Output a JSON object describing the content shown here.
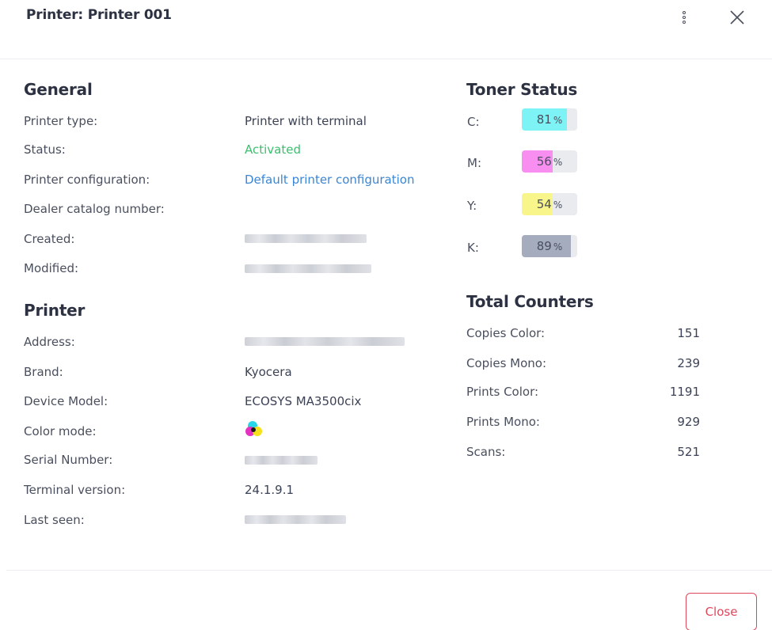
{
  "dialog": {
    "title": "Printer: Printer 001",
    "close_button_label": "Close"
  },
  "general": {
    "heading": "General",
    "rows": [
      {
        "label": "Printer type:",
        "value": "Printer with terminal"
      },
      {
        "label": "Status:",
        "value": "Activated"
      },
      {
        "label": "Printer configuration:",
        "value": "Default printer configuration"
      },
      {
        "label": "Dealer catalog number:",
        "value": ""
      },
      {
        "label": "Created:",
        "value": ""
      },
      {
        "label": "Modified:",
        "value": ""
      }
    ]
  },
  "printer": {
    "heading": "Printer",
    "rows": [
      {
        "label": "Address:",
        "value": ""
      },
      {
        "label": "Brand:",
        "value": "Kyocera"
      },
      {
        "label": "Device Model:",
        "value": "ECOSYS MA3500cix"
      },
      {
        "label": "Color mode:",
        "value": ""
      },
      {
        "label": "Serial Number:",
        "value": ""
      },
      {
        "label": "Terminal version:",
        "value": "24.1.9.1"
      },
      {
        "label": "Last seen:",
        "value": ""
      }
    ]
  },
  "toner": {
    "heading": "Toner Status",
    "unit": "%",
    "items": [
      {
        "label": "C:",
        "value": "81",
        "level": 0.81,
        "color": "#7ef3f5"
      },
      {
        "label": "M:",
        "value": "56",
        "level": 0.56,
        "color": "#f78ef0"
      },
      {
        "label": "Y:",
        "value": "54",
        "level": 0.54,
        "color": "#f8f68a"
      },
      {
        "label": "K:",
        "value": "89",
        "level": 0.89,
        "color": "#a4acbd"
      }
    ]
  },
  "counters": {
    "heading": "Total Counters",
    "rows": [
      {
        "label": "Copies Color:",
        "value": "151"
      },
      {
        "label": "Copies Mono:",
        "value": "239"
      },
      {
        "label": "Prints Color:",
        "value": "1191"
      },
      {
        "label": "Prints Mono:",
        "value": "929"
      },
      {
        "label": "Scans:",
        "value": "521"
      }
    ]
  },
  "icons": {
    "more": "more-vertical-icon",
    "close": "close-icon",
    "color_mode": "color-mode-cmy-icon"
  },
  "colors": {
    "status_active": "#3bbf6e",
    "link": "#3a86d4",
    "danger": "#e0475b"
  }
}
